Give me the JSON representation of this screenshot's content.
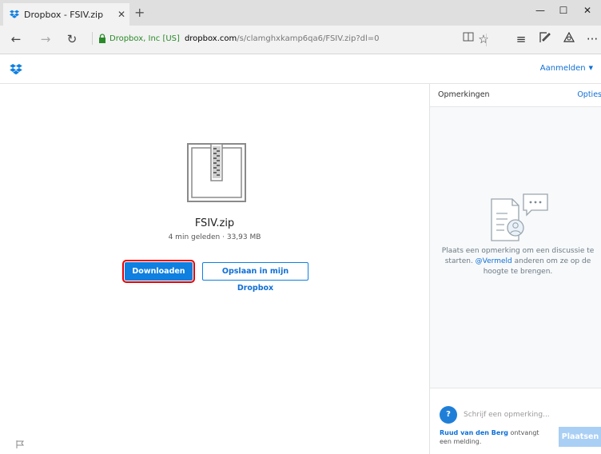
{
  "browser": {
    "tab_title": "Dropbox - FSIV.zip",
    "tab_close": "✕",
    "new_tab": "+",
    "window": {
      "minimize": "—",
      "maximize": "☐",
      "close": "✕"
    },
    "nav": {
      "back": "←",
      "forward": "→",
      "refresh": "↻"
    },
    "address": {
      "certificate": "Dropbox, Inc [US]",
      "domain": "dropbox.com",
      "path": "/s/clamghxkamp6qa6/FSIV.zip?dl=0"
    },
    "toolbar": {
      "reading_view": "📖",
      "favorite": "☆",
      "hub": "≡",
      "web_note": "✎",
      "share": "⚲",
      "more": "···"
    }
  },
  "site": {
    "signin_label": "Aanmelden",
    "signin_caret": "▼"
  },
  "file": {
    "name": "FSIV.zip",
    "meta": "4 min geleden · 33,93 MB",
    "download_label": "Downloaden",
    "save_label": "Opslaan in mijn Dropbox"
  },
  "comments": {
    "title": "Opmerkingen",
    "options_label": "Opties",
    "empty_text_1": "Plaats een opmerking om een discussie te starten. ",
    "empty_mention": "@Vermeld",
    "empty_text_2": " anderen om ze op de hoogte te brengen.",
    "avatar_letter": "?",
    "input_placeholder": "Schrijf een opmerking...",
    "notice_user": "Ruud van den Berg",
    "notice_text": " ontvangt een melding.",
    "post_label": "Plaatsen"
  },
  "colors": {
    "accent": "#0f7fe0",
    "highlight_border": "#e60000",
    "disabled_button": "#a9cff4"
  }
}
